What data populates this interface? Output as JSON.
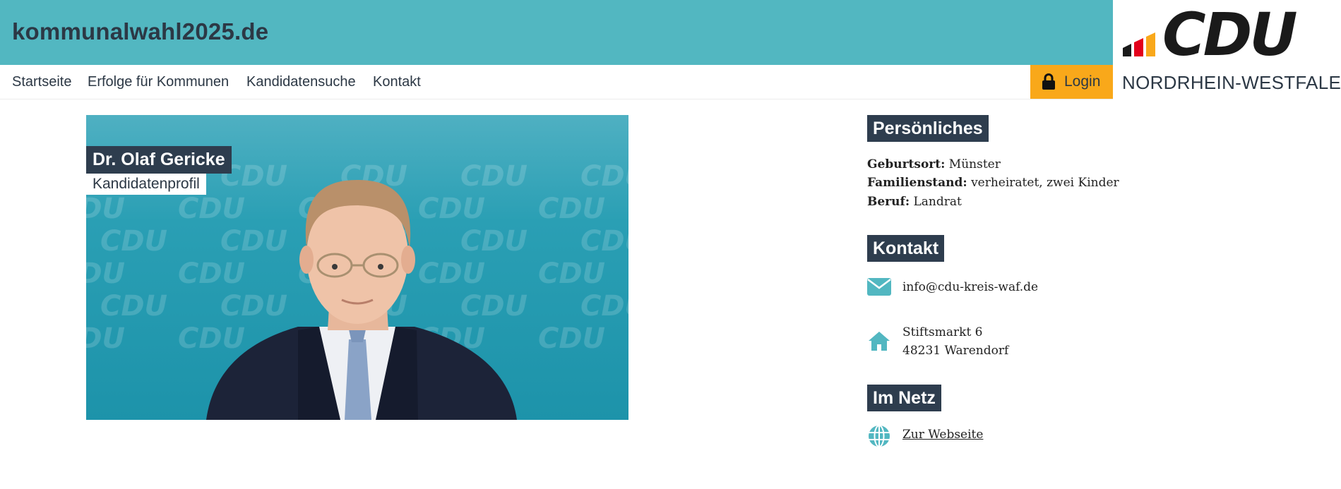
{
  "site": {
    "title": "kommunalwahl2025.de"
  },
  "logo": {
    "name": "CDU",
    "region": "NORDRHEIN-WESTFALEN",
    "bar_colors": [
      "#1a1a1a",
      "#e3001b",
      "#f9a81a"
    ]
  },
  "nav": {
    "items": [
      {
        "label": "Startseite"
      },
      {
        "label": "Erfolge für Kommunen"
      },
      {
        "label": "Kandidatensuche"
      },
      {
        "label": "Kontakt"
      }
    ],
    "login_label": "Login",
    "login_icon": "lock-icon"
  },
  "candidate": {
    "name": "Dr. Olaf Gericke",
    "subtitle": "Kandidatenprofil",
    "backdrop_text": "CDU"
  },
  "personal": {
    "heading": "Persönliches",
    "birthplace_label": "Geburtsort:",
    "birthplace": "Münster",
    "family_label": "Familienstand:",
    "family": "verheiratet, zwei Kinder",
    "job_label": "Beruf:",
    "job": "Landrat"
  },
  "contact": {
    "heading": "Kontakt",
    "email_icon": "envelope-icon",
    "email": "info@cdu-kreis-waf.de",
    "address_icon": "home-icon",
    "street": "Stiftsmarkt 6",
    "city": "48231 Warendorf"
  },
  "web": {
    "heading": "Im Netz",
    "icon": "globe-icon",
    "link_label": "Zur Webseite"
  },
  "colors": {
    "teal": "#52b7c1",
    "navy": "#2e3d4e",
    "orange": "#f9a81a",
    "icon_teal": "#52b7c1"
  }
}
